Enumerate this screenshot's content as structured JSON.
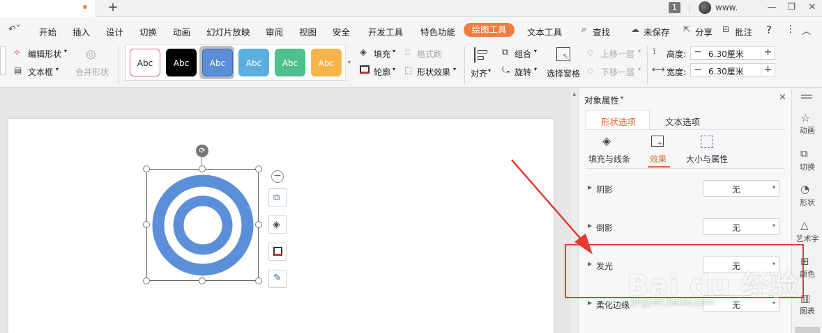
{
  "titlebar": {
    "badge": "1",
    "user": "www.",
    "add": "+"
  },
  "menu": {
    "items": [
      "开始",
      "插入",
      "设计",
      "切换",
      "动画",
      "幻灯片放映",
      "审阅",
      "视图",
      "安全",
      "开发工具",
      "特色功能"
    ],
    "active": "绘图工具",
    "text_tools": "文本工具",
    "search": "查找",
    "unsaved": "未保存",
    "share": "分享",
    "annotate": "批注",
    "help": "?"
  },
  "ribbon": {
    "edit_shape": "编辑形状",
    "text_box": "文本框",
    "merge_shape": "合并形状",
    "style_label": "Abc",
    "fill": "填充",
    "format_brush": "格式刷",
    "outline": "轮廓",
    "shape_effect": "形状效果",
    "align": "对齐",
    "group": "组合",
    "rotate": "旋转",
    "selection_pane": "选择窗格",
    "bring_forward": "上移一层",
    "send_backward": "下移一层",
    "height_label": "高度:",
    "height_value": "6.30厘米",
    "width_label": "宽度:",
    "width_value": "6.30厘米",
    "minus": "−",
    "plus": "+"
  },
  "styles": [
    {
      "bg": "#ffffff",
      "fg": "#222222",
      "border": "#d9667a"
    },
    {
      "bg": "#000000",
      "fg": "#ffffff",
      "border": "#000000"
    },
    {
      "bg": "#5a8fd8",
      "fg": "#ffffff",
      "border": "#3a6fb8"
    },
    {
      "bg": "#5aaee0",
      "fg": "#ffffff",
      "border": "#5aaee0"
    },
    {
      "bg": "#4fc08d",
      "fg": "#ffffff",
      "border": "#4fc08d"
    },
    {
      "bg": "#f8b449",
      "fg": "#ffffff",
      "border": "#f8b449"
    }
  ],
  "panel": {
    "title": "对象属性",
    "tab_shape": "形状选项",
    "tab_text": "文本选项",
    "sub_fill_line": "填充与线条",
    "sub_effect": "效果",
    "sub_size": "大小与属性",
    "sections": [
      {
        "label": "阴影",
        "value": "无"
      },
      {
        "label": "倒影",
        "value": "无"
      },
      {
        "label": "发光",
        "value": "无"
      },
      {
        "label": "柔化边缘",
        "value": "无"
      }
    ]
  },
  "rightbar": [
    "动画",
    "切换",
    "形状",
    "艺术字",
    "颜色",
    "图表"
  ],
  "watermark": {
    "logo": "Bai du 经验",
    "url": "jingyan.baidu.com"
  },
  "colors": {
    "accent": "#f07c42",
    "shape": "#5b8fd9",
    "highlight": "#e53935"
  }
}
